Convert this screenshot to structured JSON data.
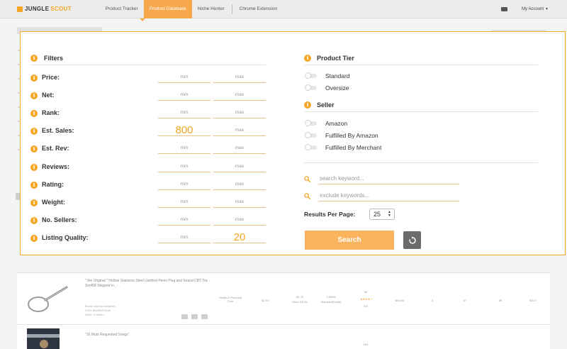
{
  "nav": {
    "logo_part1": "JUNGLE",
    "logo_part2": "SCOUT",
    "items": [
      {
        "label": "Product Tracker",
        "active": false
      },
      {
        "label": "Product Database",
        "active": true
      },
      {
        "label": "Niche Hunter",
        "active": false
      },
      {
        "label": "Chrome Extension",
        "active": false
      }
    ],
    "account": "My Account"
  },
  "filters": {
    "title": "Filters",
    "min_placeholder": "min",
    "max_placeholder": "max",
    "rows": [
      {
        "label": "Price:",
        "min": "",
        "max": ""
      },
      {
        "label": "Net:",
        "min": "",
        "max": ""
      },
      {
        "label": "Rank:",
        "min": "",
        "max": ""
      },
      {
        "label": "Est. Sales:",
        "min": "800",
        "max": ""
      },
      {
        "label": "Est. Rev:",
        "min": "",
        "max": ""
      },
      {
        "label": "Reviews:",
        "min": "",
        "max": ""
      },
      {
        "label": "Rating:",
        "min": "",
        "max": ""
      },
      {
        "label": "Weight:",
        "min": "",
        "max": ""
      },
      {
        "label": "No. Sellers:",
        "min": "",
        "max": ""
      },
      {
        "label": "Listing Quality:",
        "min": "",
        "max": "20"
      }
    ]
  },
  "product_tier": {
    "title": "Product Tier",
    "options": [
      "Standard",
      "Oversize"
    ]
  },
  "seller": {
    "title": "Seller",
    "options": [
      "Amazon",
      "Fulfilled By Amazon",
      "Fulfilled By Merchant"
    ]
  },
  "search": {
    "keyword_placeholder": "search keyword...",
    "exclude_placeholder": "exclude keywords...",
    "results_label": "Results Per Page:",
    "results_value": "25",
    "button_label": "Search"
  },
  "results": [
    {
      "title": "\" the Original \" Hollow Stainless Steel Urethral Penis Plug and Sound CBT Toy - Sm458 Shipped in . . .",
      "brand": "Brand: Imperia Industries",
      "asin": "ASIN: B008NUFUXM",
      "sellers": "Seller: 4 Sellers",
      "category": "Health & Personal Care",
      "price": "$4.54",
      "fees": "$1.78",
      "fees2": "Fees: $3.34",
      "weight": "0.02lbs",
      "size": "Standard(Small)",
      "rank": "36",
      "reviews_small": "3.6",
      "sales": "$5,060",
      "col1": "4",
      "col2": "57",
      "col3": "36",
      "col4": "$213"
    },
    {
      "title": "\"16 Most Requested Songs\"",
      "rank": "109"
    }
  ],
  "colors": {
    "accent": "#f5a623",
    "button": "#fbb45e",
    "reset": "#6b6b6b"
  },
  "icons": [
    "info-icon",
    "search-icon",
    "refresh-icon",
    "mail-icon",
    "caret-down-icon"
  ]
}
